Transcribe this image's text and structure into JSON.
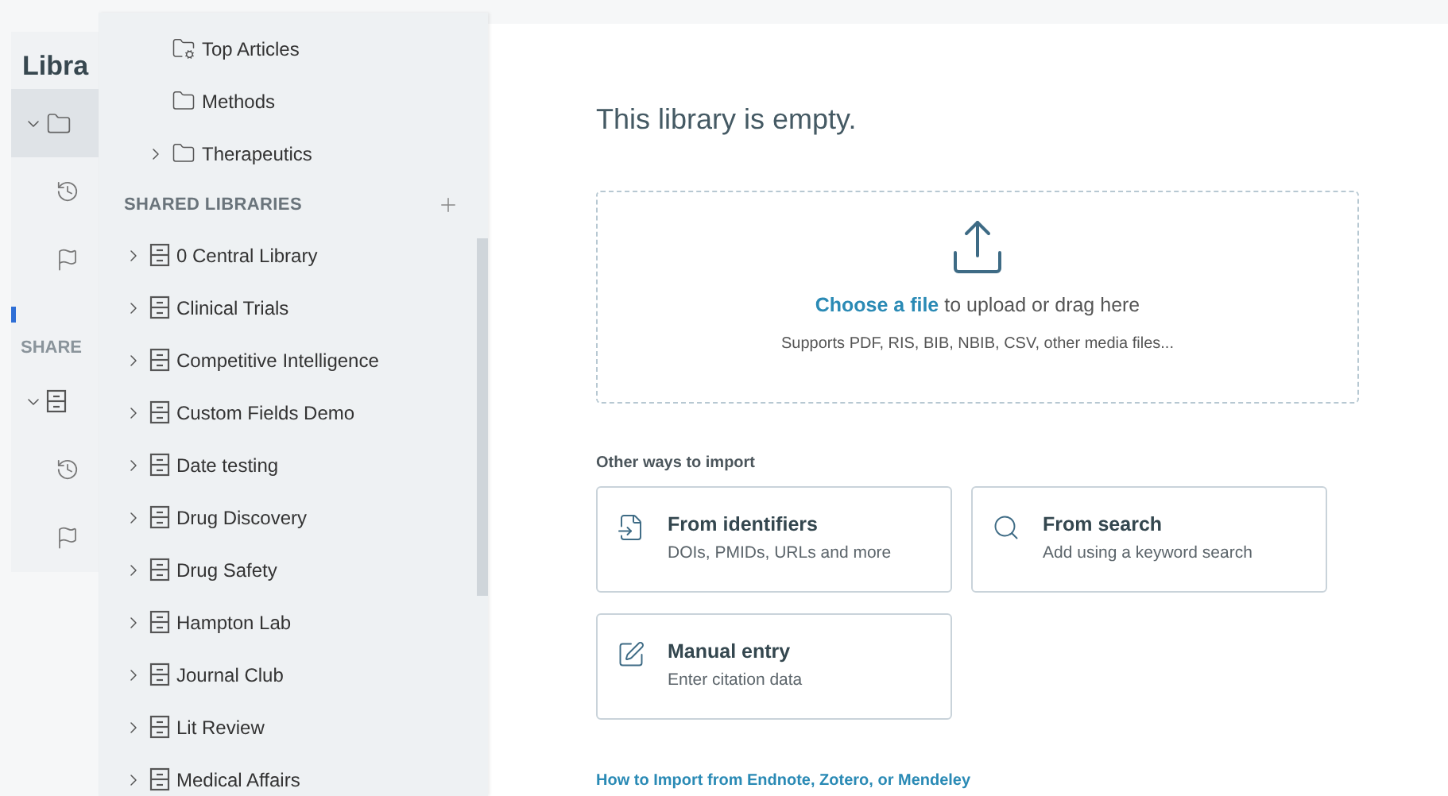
{
  "background_sidebar": {
    "title": "Libra",
    "section_label": "SHARE",
    "rows": [
      {
        "kind": "folder",
        "expanded": true,
        "selected": true
      },
      {
        "kind": "history"
      },
      {
        "kind": "flag"
      },
      {
        "kind": "section"
      },
      {
        "kind": "library",
        "expanded": true,
        "selected": false
      },
      {
        "kind": "history"
      },
      {
        "kind": "flag"
      }
    ]
  },
  "folders_panel": {
    "folders": [
      {
        "label": "Top Articles",
        "kind": "smart"
      },
      {
        "label": "Methods",
        "kind": "folder"
      },
      {
        "label": "Therapeutics",
        "kind": "parent",
        "expanded": false
      }
    ],
    "shared_heading": "SHARED LIBRARIES",
    "libraries": [
      {
        "label": "0 Central Library",
        "expanded": false
      },
      {
        "label": "Clinical Trials",
        "expanded": false
      },
      {
        "label": "Competitive Intelligence",
        "expanded": false
      },
      {
        "label": "Custom Fields Demo",
        "expanded": false
      },
      {
        "label": "Date testing",
        "expanded": false
      },
      {
        "label": "Drug Discovery",
        "expanded": false
      },
      {
        "label": "Drug Safety",
        "expanded": false
      },
      {
        "label": "Hampton Lab",
        "expanded": false
      },
      {
        "label": "Journal Club",
        "expanded": false
      },
      {
        "label": "Lit Review",
        "expanded": false
      },
      {
        "label": "Medical Affairs",
        "expanded": false
      }
    ]
  },
  "main": {
    "title": "This library is empty.",
    "dropzone": {
      "link": "Choose a file",
      "text": "to upload or drag here",
      "hint": "Supports PDF, RIS, BIB, NBIB, CSV, other media files..."
    },
    "other_heading": "Other ways to import",
    "options": [
      {
        "kind": "identifiers",
        "title": "From identifiers",
        "subtitle": "DOIs, PMIDs, URLs and more"
      },
      {
        "kind": "search",
        "title": "From search",
        "subtitle": "Add using a keyword search"
      },
      {
        "kind": "manual",
        "title": "Manual entry",
        "subtitle": "Enter citation data"
      }
    ],
    "help_link": "How to Import from Endnote, Zotero, or Mendeley"
  }
}
